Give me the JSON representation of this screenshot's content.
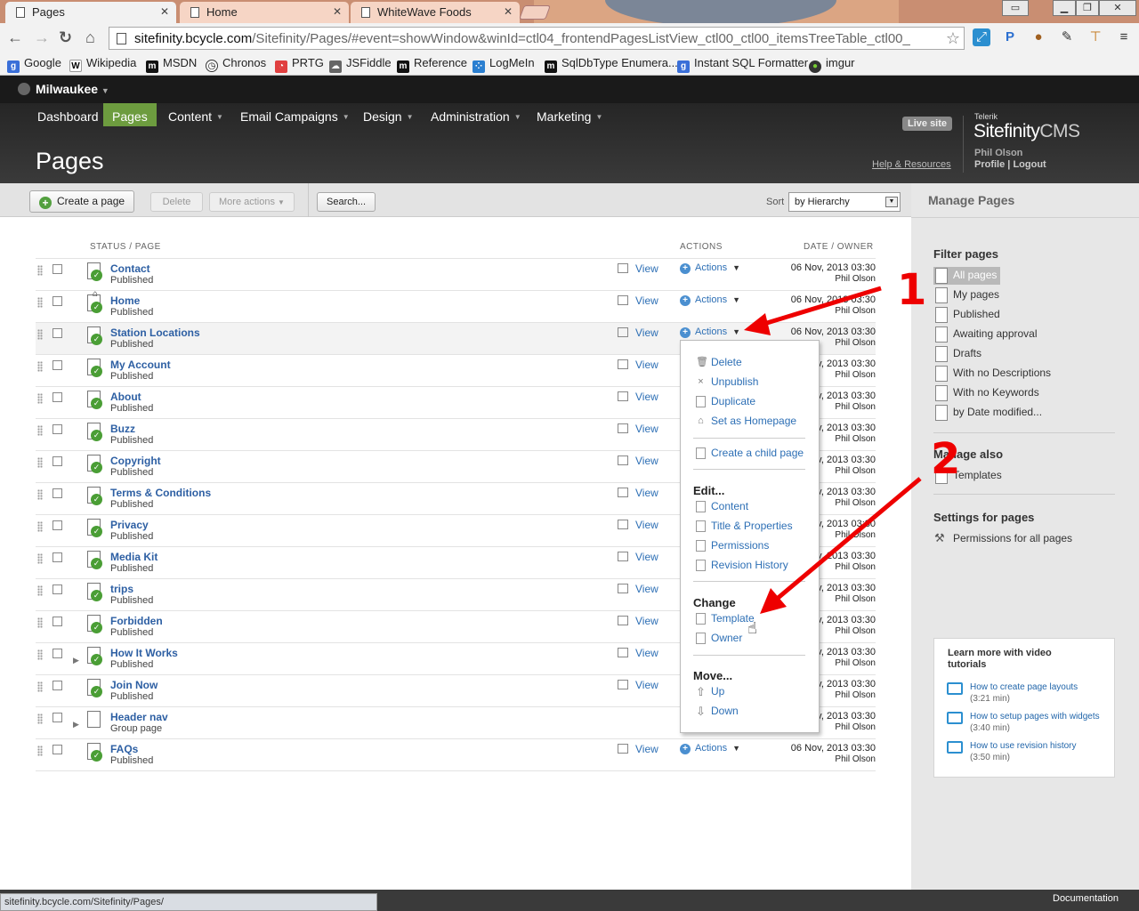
{
  "browser": {
    "tabs": [
      {
        "label": "Pages",
        "active": true
      },
      {
        "label": "Home",
        "active": false
      },
      {
        "label": "WhiteWave Foods",
        "active": false
      }
    ],
    "url_host": "sitefinity.bcycle.com",
    "url_path": "/Sitefinity/Pages/#event=showWindow&winId=ctl04_frontendPagesListView_ctl00_ctl00_itemsTreeTable_ctl00_",
    "bookmarks": [
      "Google",
      "Wikipedia",
      "MSDN",
      "Chronos",
      "PRTG",
      "JSFiddle",
      "Reference",
      "LogMeIn",
      "SqlDbType Enumera...",
      "Instant SQL Formatter",
      "imgur"
    ],
    "status_url": "sitefinity.bcycle.com/Sitefinity/Pages/"
  },
  "site": {
    "name": "Milwaukee"
  },
  "nav": {
    "items": [
      {
        "label": "Dashboard",
        "dropdown": false,
        "active": false
      },
      {
        "label": "Pages",
        "dropdown": false,
        "active": true
      },
      {
        "label": "Content",
        "dropdown": true,
        "active": false
      },
      {
        "label": "Email Campaigns",
        "dropdown": true,
        "active": false
      },
      {
        "label": "Design",
        "dropdown": true,
        "active": false
      },
      {
        "label": "Administration",
        "dropdown": true,
        "active": false
      },
      {
        "label": "Marketing",
        "dropdown": true,
        "active": false
      }
    ]
  },
  "header": {
    "title": "Pages",
    "live_site": "Live site",
    "help": "Help & Resources",
    "vendor": "Telerik",
    "product_a": "Sitefinity",
    "product_b": "CMS",
    "user": "Phil Olson",
    "profile": "Profile",
    "logout": "Logout"
  },
  "toolbar": {
    "create": "Create a page",
    "delete": "Delete",
    "more": "More actions",
    "search": "Search...",
    "sort_label": "Sort",
    "sort_value": "by Hierarchy"
  },
  "table": {
    "col_status": "STATUS / PAGE",
    "col_actions": "ACTIONS",
    "col_date": "DATE / OWNER",
    "view_label": "View",
    "actions_label": "Actions",
    "rows": [
      {
        "title": "Contact",
        "status": "Published",
        "date": "06 Nov, 2013 03:30",
        "owner": "Phil Olson"
      },
      {
        "title": "Home",
        "status": "Published",
        "date": "06 Nov, 2013 03:30",
        "owner": "Phil Olson"
      },
      {
        "title": "Station Locations",
        "status": "Published",
        "date": "06 Nov, 2013 03:30",
        "owner": "Phil Olson"
      },
      {
        "title": "My Account",
        "status": "Published",
        "date": "06 Nov, 2013 03:30",
        "owner": "Phil Olson"
      },
      {
        "title": "About",
        "status": "Published",
        "date": "06 Nov, 2013 03:30",
        "owner": "Phil Olson"
      },
      {
        "title": "Buzz",
        "status": "Published",
        "date": "06 Nov, 2013 03:30",
        "owner": "Phil Olson"
      },
      {
        "title": "Copyright",
        "status": "Published",
        "date": "06 Nov, 2013 03:30",
        "owner": "Phil Olson"
      },
      {
        "title": "Terms & Conditions",
        "status": "Published",
        "date": "06 Nov, 2013 03:30",
        "owner": "Phil Olson"
      },
      {
        "title": "Privacy",
        "status": "Published",
        "date": "06 Nov, 2013 03:30",
        "owner": "Phil Olson"
      },
      {
        "title": "Media Kit",
        "status": "Published",
        "date": "06 Nov, 2013 03:30",
        "owner": "Phil Olson"
      },
      {
        "title": "trips",
        "status": "Published",
        "date": "06 Nov, 2013 03:30",
        "owner": "Phil Olson"
      },
      {
        "title": "Forbidden",
        "status": "Published",
        "date": "06 Nov, 2013 03:30",
        "owner": "Phil Olson"
      },
      {
        "title": "How It Works",
        "status": "Published",
        "date": "06 Nov, 2013 03:30",
        "owner": "Phil Olson"
      },
      {
        "title": "Join Now",
        "status": "Published",
        "date": "06 Nov, 2013 03:30",
        "owner": "Phil Olson"
      },
      {
        "title": "Header nav",
        "status": "Group page",
        "date": "06 Nov, 2013 03:30",
        "owner": "Phil Olson"
      },
      {
        "title": "FAQs",
        "status": "Published",
        "date": "06 Nov, 2013 03:30",
        "owner": "Phil Olson"
      }
    ]
  },
  "actions_menu": {
    "delete": "Delete",
    "unpublish": "Unpublish",
    "duplicate": "Duplicate",
    "set_homepage": "Set as Homepage",
    "create_child": "Create a child page",
    "edit_heading": "Edit...",
    "content": "Content",
    "title_props": "Title & Properties",
    "permissions": "Permissions",
    "revision_history": "Revision History",
    "change_heading": "Change",
    "template": "Template",
    "owner": "Owner",
    "move_heading": "Move...",
    "up": "Up",
    "down": "Down"
  },
  "sidebar": {
    "title": "Manage Pages",
    "filter_heading": "Filter pages",
    "filters": [
      "All pages",
      "My pages",
      "Published",
      "Awaiting approval",
      "Drafts",
      "With no Descriptions",
      "With no Keywords",
      "by Date modified..."
    ],
    "manage_also_heading": "Manage also",
    "templates": "Templates",
    "settings_heading": "Settings for pages",
    "permissions_all": "Permissions for all pages",
    "video_title": "Learn more with video tutorials",
    "videos": [
      {
        "title": "How to create page layouts",
        "duration": "(3:21 min)"
      },
      {
        "title": "How to setup pages with widgets",
        "duration": "(3:40 min)"
      },
      {
        "title": "How to use revision history",
        "duration": "(3:50 min)"
      }
    ]
  },
  "annotations": {
    "one": "1",
    "two": "2"
  },
  "footer": {
    "documentation": "Documentation"
  },
  "colors": {
    "accent_green": "#6d9c3f",
    "link_blue": "#2d6fb5",
    "annotation_red": "#e00000"
  }
}
